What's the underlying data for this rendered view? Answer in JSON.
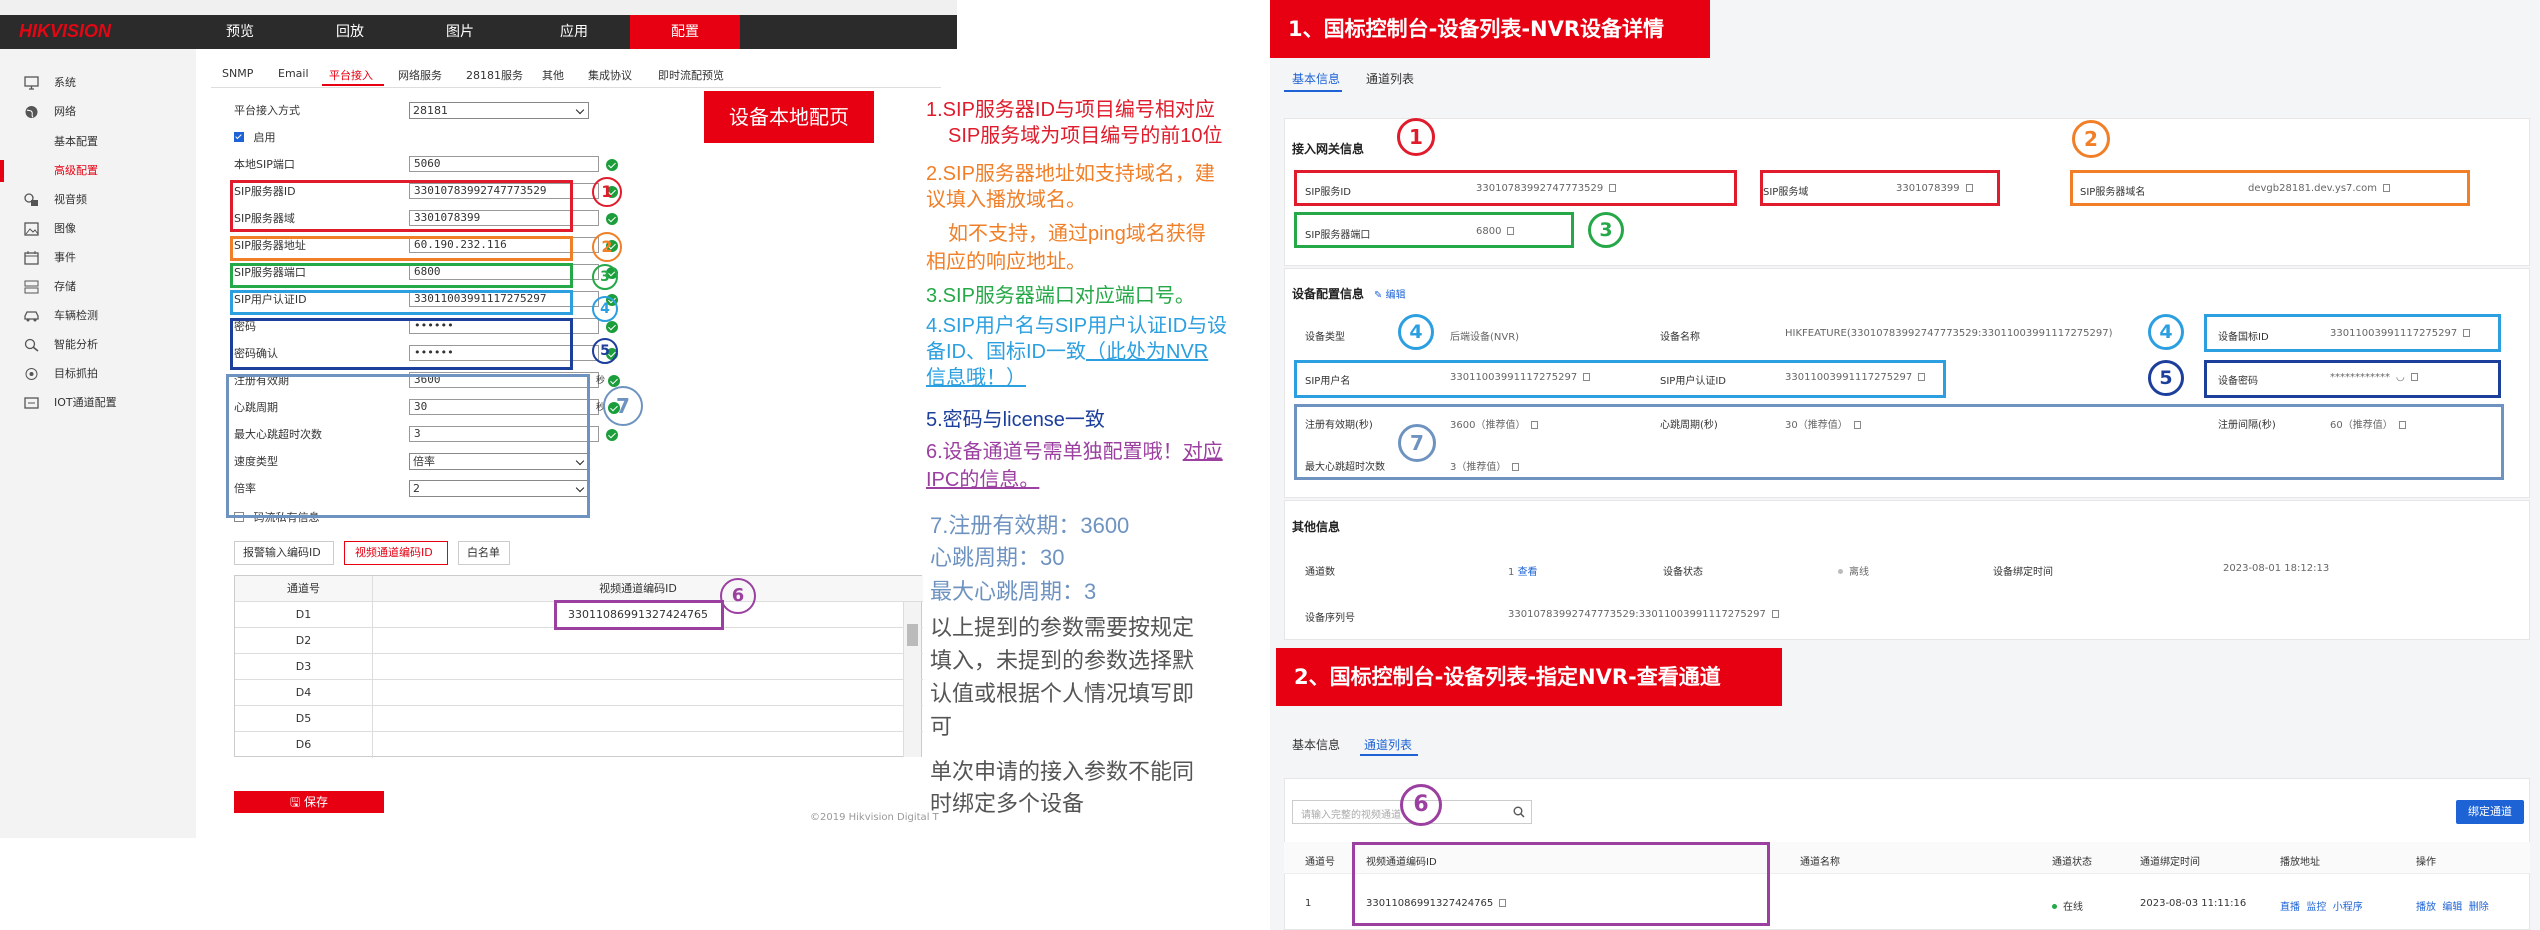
{
  "colors": {
    "brand_red": "#e60012",
    "box_red": "#e01b2b",
    "box_orange": "#f07f28",
    "box_green": "#25a847",
    "box_lightblue": "#2b9fe0",
    "box_darkblue": "#1d3f9c",
    "box_steel": "#6f93c0",
    "box_purple": "#9b3fa0",
    "link_blue": "#1e63d6"
  },
  "left": {
    "logo": "HIKVISION",
    "nav": [
      "预览",
      "回放",
      "图片",
      "应用",
      "配置"
    ],
    "sidebar": [
      {
        "label": "系统",
        "icon": "monitor-icon"
      },
      {
        "label": "网络",
        "icon": "globe-icon"
      },
      {
        "label": "基本配置",
        "icon": ""
      },
      {
        "label": "高级配置",
        "icon": ""
      },
      {
        "label": "视音频",
        "icon": "audio-video-icon"
      },
      {
        "label": "图像",
        "icon": "image-icon"
      },
      {
        "label": "事件",
        "icon": "calendar-icon"
      },
      {
        "label": "存储",
        "icon": "storage-icon"
      },
      {
        "label": "车辆检测",
        "icon": "car-icon"
      },
      {
        "label": "智能分析",
        "icon": "analysis-icon"
      },
      {
        "label": "目标抓拍",
        "icon": "target-icon"
      },
      {
        "label": "IOT通道配置",
        "icon": "iot-icon"
      }
    ],
    "tabs": [
      "SNMP",
      "Email",
      "平台接入",
      "网络服务",
      "28181服务",
      "其他",
      "集成协议",
      "即时流配预览"
    ],
    "form": {
      "access_mode_label": "平台接入方式",
      "access_mode_value": "28181",
      "enable_label": "启用",
      "local_sip_port_label": "本地SIP端口",
      "local_sip_port_value": "5060",
      "sip_server_id_label": "SIP服务器ID",
      "sip_server_id_value": "33010783992747773529",
      "sip_server_domain_label": "SIP服务器域",
      "sip_server_domain_value": "3301078399",
      "sip_server_addr_label": "SIP服务器地址",
      "sip_server_addr_value": "60.190.232.116",
      "sip_server_port_label": "SIP服务器端口",
      "sip_server_port_value": "6800",
      "sip_user_auth_id_label": "SIP用户认证ID",
      "sip_user_auth_id_value": "33011003991117275297",
      "password_label": "密码",
      "password_value": "••••••",
      "password_confirm_label": "密码确认",
      "password_confirm_value": "••••••",
      "reg_expiry_label": "注册有效期",
      "reg_expiry_value": "3600",
      "reg_expiry_unit": "秒",
      "heartbeat_label": "心跳周期",
      "heartbeat_value": "30",
      "heartbeat_unit": "秒",
      "max_timeout_label": "最大心跳超时次数",
      "max_timeout_value": "3",
      "speed_type_label": "速度类型",
      "speed_type_value": "倍率",
      "rate_label": "倍率",
      "rate_value": "2",
      "private_label": "码流私有信息"
    },
    "subtabs": [
      "报警输入编码ID",
      "视频通道编码ID",
      "白名单"
    ],
    "grid": {
      "headers": [
        "通道号",
        "视频通道编码ID"
      ],
      "rows": [
        {
          "ch": "D1",
          "id": "33011086991327424765"
        },
        {
          "ch": "D2",
          "id": ""
        },
        {
          "ch": "D3",
          "id": ""
        },
        {
          "ch": "D4",
          "id": ""
        },
        {
          "ch": "D5",
          "id": ""
        },
        {
          "ch": "D6",
          "id": ""
        }
      ]
    },
    "save_label": "保存",
    "copyright": "©2019 Hikvision Digital T",
    "callout": "设备本地配页"
  },
  "circles": [
    "1",
    "2",
    "3",
    "4",
    "5",
    "6",
    "7"
  ],
  "notes": {
    "n1": "1.SIP服务器ID与项目编号相对应",
    "n1b": "SIP服务域为项目编号的前10位",
    "n2a": "2.SIP服务器地址如支持域名，建",
    "n2b": "议填入播放域名。",
    "n2c": "如不支持，通过ping域名获得",
    "n2d": "相应的响应地址。",
    "n3": "3.SIP服务器端口对应端口号。",
    "n4a": "4.SIP用户名与SIP用户认证ID与设",
    "n4b1": "备ID、国标ID一致",
    "n4b2": "（此处为NVR",
    "n4c": "信息哦！）",
    "n5": "5.密码与license一致",
    "n6a1": "6.设备通道号需单独配置哦！",
    "n6a2": "对应",
    "n6b": "IPC的信息。",
    "n7a": "7.注册有效期：3600",
    "n7b": "心跳周期：30",
    "n7c": "最大心跳周期：3",
    "p1a": "以上提到的参数需要按规定",
    "p1b": "填入，未提到的参数选择默",
    "p1c": "认值或根据个人情况填写即",
    "p1d": "可",
    "p2a": "单次申请的接入参数不能同",
    "p2b": "时绑定多个设备"
  },
  "right1": {
    "header": "1、国标控制台-设备列表-NVR设备详情",
    "tabs": [
      "基本信息",
      "通道列表"
    ],
    "gateway_title": "接入网关信息",
    "sip_id_label": "SIP服务ID",
    "sip_id_value": "33010783992747773529",
    "sip_domain_label": "SIP服务域",
    "sip_domain_value": "3301078399",
    "sip_host_label": "SIP服务器域名",
    "sip_host_value": "devgb28181.dev.ys7.com",
    "sip_port_label": "SIP服务器端口",
    "sip_port_value": "6800",
    "device_title": "设备配置信息",
    "edit_label": "编辑",
    "dev_type_label": "设备类型",
    "dev_type_value": "后端设备(NVR)",
    "dev_name_label": "设备名称",
    "dev_name_value": "HIKFEATURE(33010783992747773529:33011003991117275297)",
    "gb_id_label": "设备国标ID",
    "gb_id_value": "33011003991117275297",
    "sip_user_label": "SIP用户名",
    "sip_user_value": "33011003991117275297",
    "sip_auth_label": "SIP用户认证ID",
    "sip_auth_value": "33011003991117275297",
    "dev_pwd_label": "设备密码",
    "dev_pwd_value": "************",
    "reg_label": "注册有效期(秒)",
    "reg_value": "3600（推荐值）",
    "hb_label": "心跳周期(秒)",
    "hb_value": "30（推荐值）",
    "int_label": "注册间隔(秒)",
    "int_value": "60（推荐值）",
    "maxhb_label": "最大心跳超时次数",
    "maxhb_value": "3（推荐值）",
    "other_title": "其他信息",
    "ch_count_label": "通道数",
    "ch_count_value": "1",
    "view_label": "查看",
    "status_label": "设备状态",
    "status_value": "离线",
    "bind_time_label": "设备绑定时间",
    "bind_time_value": "2023-08-01 18:12:13",
    "serial_label": "设备序列号",
    "serial_value": "33010783992747773529:33011003991117275297"
  },
  "right2": {
    "header": "2、国标控制台-设备列表-指定NVR-查看通道",
    "tabs": [
      "基本信息",
      "通道列表"
    ],
    "search_placeholder": "请输入完整的视频通道",
    "bind_button": "绑定通道",
    "headers": [
      "通道号",
      "视频通道编码ID",
      "通道名称",
      "通道状态",
      "通道绑定时间",
      "播放地址",
      "操作"
    ],
    "row": {
      "no": "1",
      "id": "33011086991327424765",
      "name": "",
      "status": "在线",
      "time": "2023-08-03 11:11:16",
      "play": [
        "直播",
        "监控",
        "小程序"
      ],
      "ops": [
        "播放",
        "编辑",
        "删除"
      ]
    }
  }
}
